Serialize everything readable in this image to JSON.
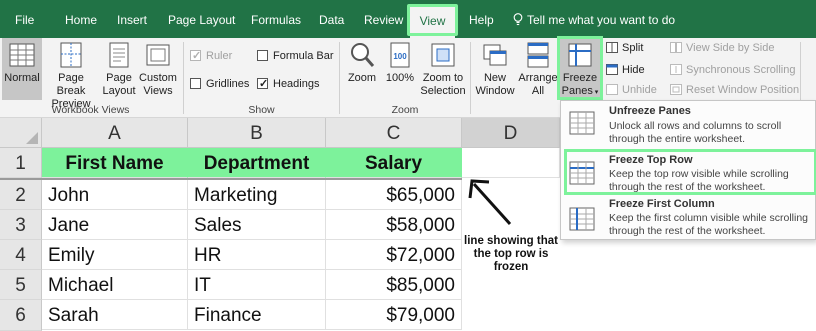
{
  "menu": {
    "tabs": [
      "File",
      "Home",
      "Insert",
      "Page Layout",
      "Formulas",
      "Data",
      "Review",
      "View",
      "Help"
    ],
    "active_tab": "View",
    "tell_me": "Tell me what you want to do"
  },
  "ribbon": {
    "workbook_views": {
      "label": "Workbook Views",
      "buttons": [
        "Normal",
        "Page Break Preview",
        "Page Layout",
        "Custom Views"
      ],
      "selected": "Normal"
    },
    "show": {
      "label": "Show",
      "ruler": "Ruler",
      "formula_bar": "Formula Bar",
      "gridlines": "Gridlines",
      "headings": "Headings"
    },
    "zoom": {
      "label": "Zoom",
      "zoom_btn": "Zoom",
      "hundred": "100%",
      "to_selection": "Zoom to Selection"
    },
    "window": {
      "new_window": "New Window",
      "arrange_all": "Arrange All",
      "freeze_panes": "Freeze Panes",
      "split": "Split",
      "hide": "Hide",
      "unhide": "Unhide",
      "side_by_side": "View Side by Side",
      "sync_scroll": "Synchronous Scrolling",
      "reset_pos": "Reset Window Position"
    }
  },
  "freeze_menu": {
    "items": [
      {
        "title": "Unfreeze Panes",
        "desc": "Unlock all rows and columns to scroll through the entire worksheet."
      },
      {
        "title": "Freeze Top Row",
        "desc": "Keep the top row visible while scrolling through the rest of the worksheet."
      },
      {
        "title": "Freeze First Column",
        "desc": "Keep the first column visible while scrolling through the rest of the worksheet."
      }
    ]
  },
  "sheet": {
    "columns": [
      "A",
      "B",
      "C",
      "D"
    ],
    "rows": [
      "1",
      "2",
      "3",
      "4",
      "5",
      "6"
    ],
    "header": [
      "First Name",
      "Department",
      "Salary"
    ],
    "data": [
      [
        "John",
        "Marketing",
        "$65,000"
      ],
      [
        "Jane",
        "Sales",
        "$58,000"
      ],
      [
        "Emily",
        "HR",
        "$72,000"
      ],
      [
        "Michael",
        "IT",
        "$85,000"
      ],
      [
        "Sarah",
        "Finance",
        "$79,000"
      ]
    ]
  },
  "annotation": "line showing that the top row is frozen",
  "colors": {
    "excel_green": "#217346",
    "highlight_green": "#7df29b",
    "ribbon_bg": "#f3f3f3"
  }
}
